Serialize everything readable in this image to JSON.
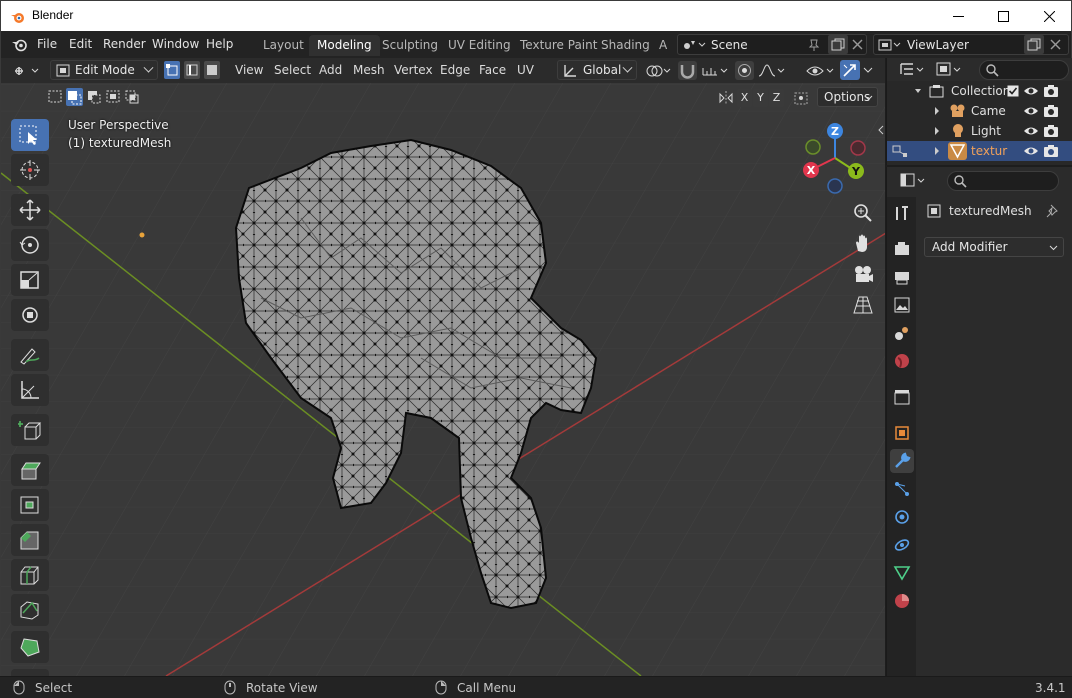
{
  "window": {
    "title": "Blender"
  },
  "menu": {
    "items": [
      "File",
      "Edit",
      "Render",
      "Window",
      "Help"
    ],
    "workspaces": [
      "Layout",
      "Modeling",
      "Sculpting",
      "UV Editing",
      "Texture Paint",
      "Shading",
      "A"
    ],
    "active_workspace": "Modeling",
    "scene": "Scene",
    "view_layer": "ViewLayer"
  },
  "viewport": {
    "mode": "Edit Mode",
    "menus": [
      "View",
      "Select",
      "Add",
      "Mesh",
      "Vertex",
      "Edge",
      "Face",
      "UV"
    ],
    "transform_orientation": "Global",
    "axis_buttons": [
      "X",
      "Y",
      "Z"
    ],
    "options_label": "Options",
    "perspective_label": "User Perspective",
    "object_label": "(1) texturedMesh",
    "gizmo": {
      "x": "X",
      "y": "Y",
      "z": "Z"
    }
  },
  "outliner": {
    "collection": "Collection",
    "items": [
      "Came",
      "Light",
      "textur"
    ]
  },
  "properties": {
    "object_name": "texturedMesh",
    "add_modifier": "Add Modifier"
  },
  "statusbar": {
    "select": "Select",
    "rotate": "Rotate View",
    "call_menu": "Call Menu",
    "version": "3.4.1"
  },
  "colors": {
    "accent": "#4772b3",
    "x_axis": "#e2364d",
    "y_axis": "#8bba1c",
    "z_axis": "#3d86e0",
    "grid_green": "#6b8e23",
    "grid_red": "#a33a3a"
  }
}
